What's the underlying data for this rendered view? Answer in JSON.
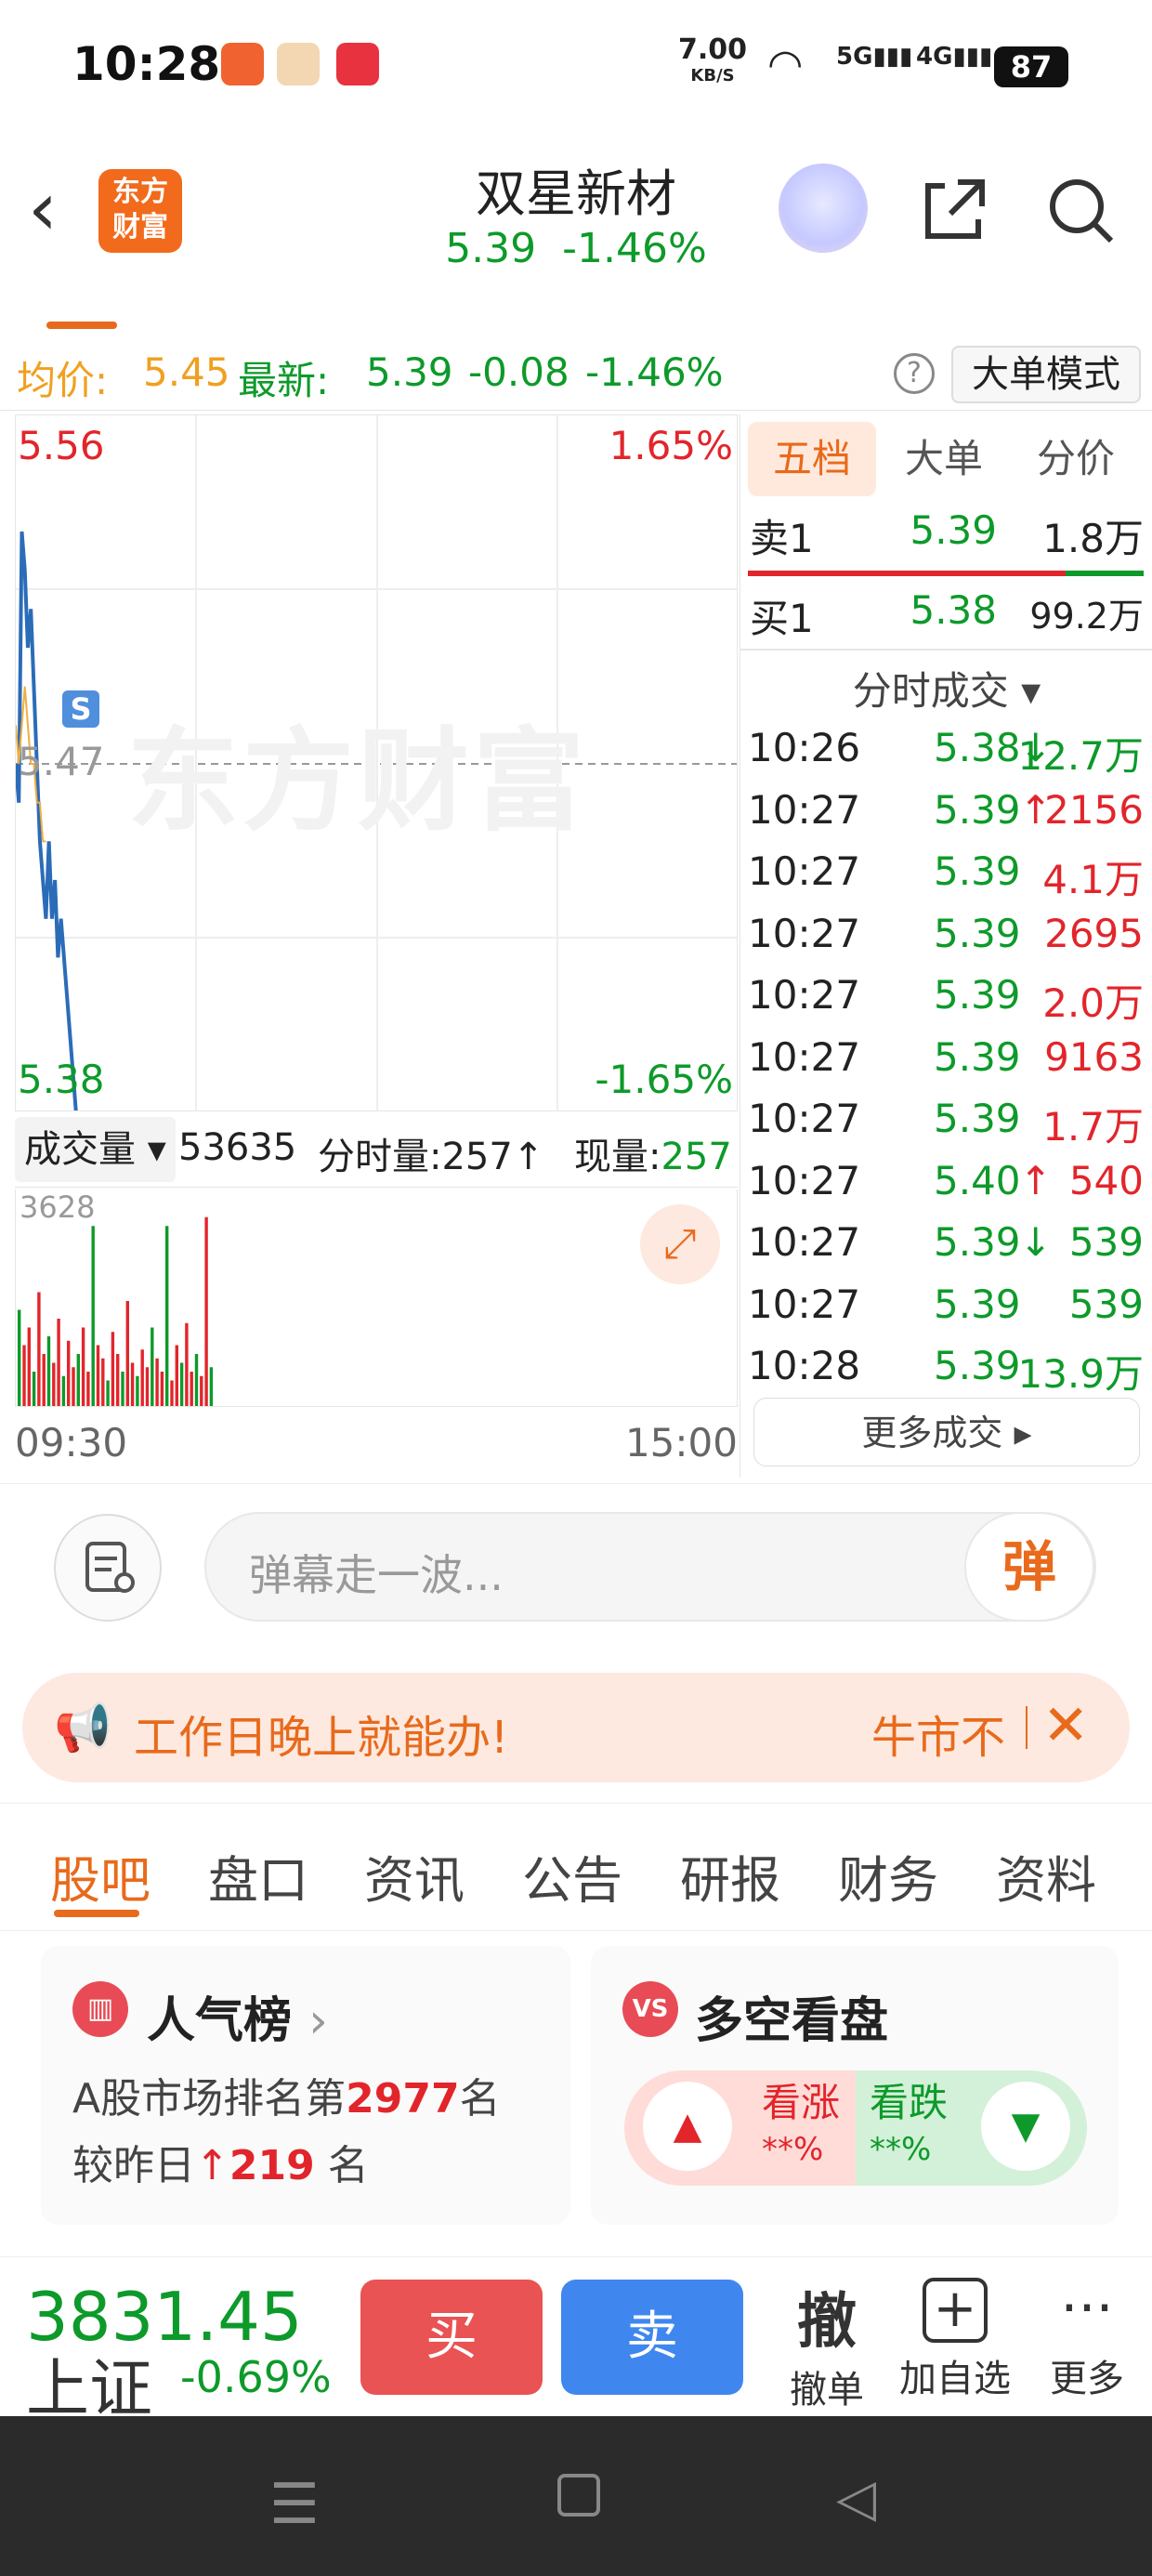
{
  "status": {
    "time": "10:28",
    "net_speed": "7.00",
    "net_unit": "KB/S",
    "sig1": "5G",
    "sig2": "4G",
    "battery": "87"
  },
  "header": {
    "stock_name": "双星新材",
    "price": "5.39",
    "change": "-1.46%",
    "logo_line1": "东方",
    "logo_line2": "财富"
  },
  "stats": {
    "avg_label": "均价:",
    "avg_value": "5.45",
    "latest_label": "最新:",
    "latest_value": "5.39",
    "chg": "-0.08",
    "pct": "-1.46%",
    "mode_button": "大单模式"
  },
  "chart": {
    "high": "5.56",
    "low": "5.38",
    "high_pct": "1.65%",
    "low_pct": "-1.65%",
    "mid": "5.47",
    "watermark": "东方财富",
    "marker": "S"
  },
  "volume": {
    "dropdown": "成交量",
    "total": "53635",
    "fenshi_label": "分时量:",
    "fenshi_value": "257",
    "xianliang_label": "现量:",
    "xianliang_value": "257",
    "max": "3628",
    "t_start": "09:30",
    "t_end": "15:00"
  },
  "chart_data": {
    "type": "line",
    "ylim": [
      5.38,
      5.56
    ],
    "series": [
      {
        "values": [
          5.47,
          5.46,
          5.53,
          5.52,
          5.5,
          5.51,
          5.49,
          5.47,
          5.45,
          5.44,
          5.43,
          5.45,
          5.43,
          5.44,
          5.42,
          5.43,
          5.42,
          5.41,
          5.4,
          5.39,
          5.38
        ]
      },
      {
        "values": [
          5.48,
          5.47,
          5.48,
          5.49,
          5.48,
          5.47,
          5.47,
          5.46,
          5.46,
          5.45,
          5.45
        ]
      }
    ]
  },
  "orderbook": {
    "tabs": [
      "五档",
      "大单",
      "分价"
    ],
    "sell1": {
      "label": "卖1",
      "price": "5.39",
      "vol": "1.8万"
    },
    "buy1": {
      "label": "买1",
      "price": "5.38",
      "vol": "99.2万"
    },
    "section": "分时成交",
    "trades": [
      {
        "t": "10:26",
        "p": "5.38",
        "arrow": "↓",
        "v": "12.7万",
        "up": false
      },
      {
        "t": "10:27",
        "p": "5.39",
        "arrow": "↑",
        "v": "2156",
        "up": true
      },
      {
        "t": "10:27",
        "p": "5.39",
        "arrow": "",
        "v": "4.1万",
        "up": true
      },
      {
        "t": "10:27",
        "p": "5.39",
        "arrow": "",
        "v": "2695",
        "up": true
      },
      {
        "t": "10:27",
        "p": "5.39",
        "arrow": "",
        "v": "2.0万",
        "up": true
      },
      {
        "t": "10:27",
        "p": "5.39",
        "arrow": "",
        "v": "9163",
        "up": true
      },
      {
        "t": "10:27",
        "p": "5.39",
        "arrow": "",
        "v": "1.7万",
        "up": true
      },
      {
        "t": "10:27",
        "p": "5.40",
        "arrow": "↑",
        "v": "540",
        "up": true
      },
      {
        "t": "10:27",
        "p": "5.39",
        "arrow": "↓",
        "v": "539",
        "up": false
      },
      {
        "t": "10:27",
        "p": "5.39",
        "arrow": "",
        "v": "539",
        "up": false
      },
      {
        "t": "10:28",
        "p": "5.39",
        "arrow": "",
        "v": "13.9万",
        "up": false
      }
    ],
    "more": "更多成交"
  },
  "danmu": {
    "placeholder": "弹幕走一波...",
    "button": "弹"
  },
  "notice": {
    "text": "工作日晚上就能办!",
    "right": "牛市不"
  },
  "section_tabs": [
    "股吧",
    "盘口",
    "资讯",
    "公告",
    "研报",
    "财务",
    "资料"
  ],
  "popularity": {
    "title": "人气榜",
    "line1_prefix": "A股市场排名第",
    "rank": "2977",
    "line1_suffix": "名",
    "line2_prefix": "较昨日",
    "change": "219",
    "line2_suffix": "名"
  },
  "sentiment": {
    "title": "多空看盘",
    "bull": "看涨",
    "bull_pct": "**%",
    "bear": "看跌",
    "bear_pct": "**%"
  },
  "bottom": {
    "index_value": "3831.45",
    "index_name": "上证",
    "index_pct": "-0.69%",
    "buy": "买",
    "sell": "卖",
    "cancel_icon": "撤",
    "cancel": "撤单",
    "add": "加自选",
    "more": "更多"
  },
  "colors": {
    "up": "#e2252b",
    "down": "#0d9a2a",
    "accent": "#e86a1c",
    "price_line": "#2b6cb8",
    "avg_line": "#f0b041"
  }
}
